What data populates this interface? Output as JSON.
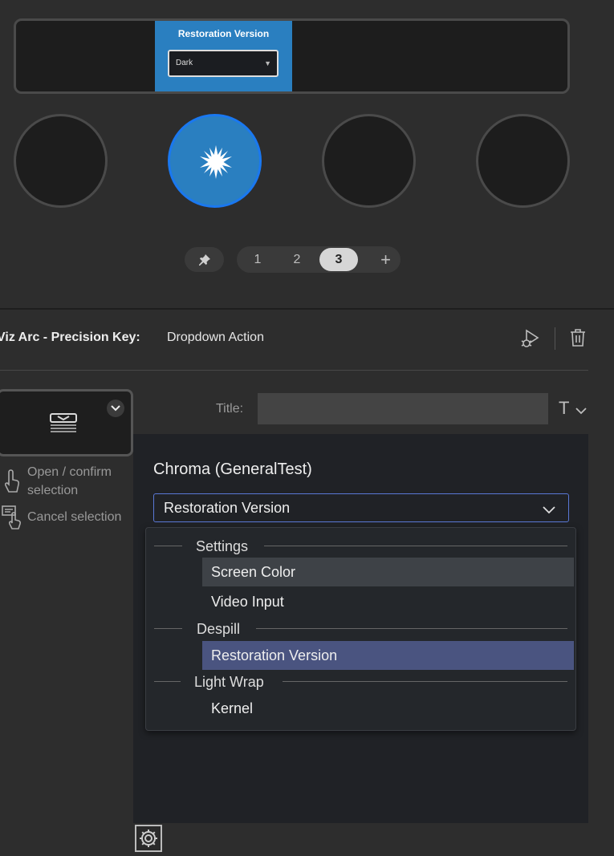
{
  "device": {
    "lcd": {
      "title": "Restoration Version",
      "dropdown_value": "Dark"
    },
    "pages": {
      "items": [
        "1",
        "2",
        "3"
      ],
      "selected": "3",
      "add_label": "+"
    }
  },
  "action": {
    "plugin_name": "Viz Arc - Precision Key:",
    "action_name": "Dropdown Action"
  },
  "hints": {
    "confirm": "Open / confirm\nselection",
    "confirm_line1": "Open / confirm",
    "confirm_line2": "selection",
    "cancel": "Cancel selection"
  },
  "title_field": {
    "label": "Title:",
    "value": "",
    "format_label": "T"
  },
  "settings": {
    "group_label": "Chroma (GeneralTest)",
    "selected_value": "Restoration Version",
    "options": {
      "settings_header": "Settings",
      "screen_color": "Screen Color",
      "video_input": "Video Input",
      "despill_header": "Despill",
      "restoration_version": "Restoration Version",
      "light_wrap_header": "Light Wrap",
      "kernel": "Kernel"
    }
  },
  "colors": {
    "accent": "#2a7fc0",
    "active_ring": "#1a78f0",
    "selected_option": "#4a5480",
    "select_border": "#5a78d6"
  }
}
